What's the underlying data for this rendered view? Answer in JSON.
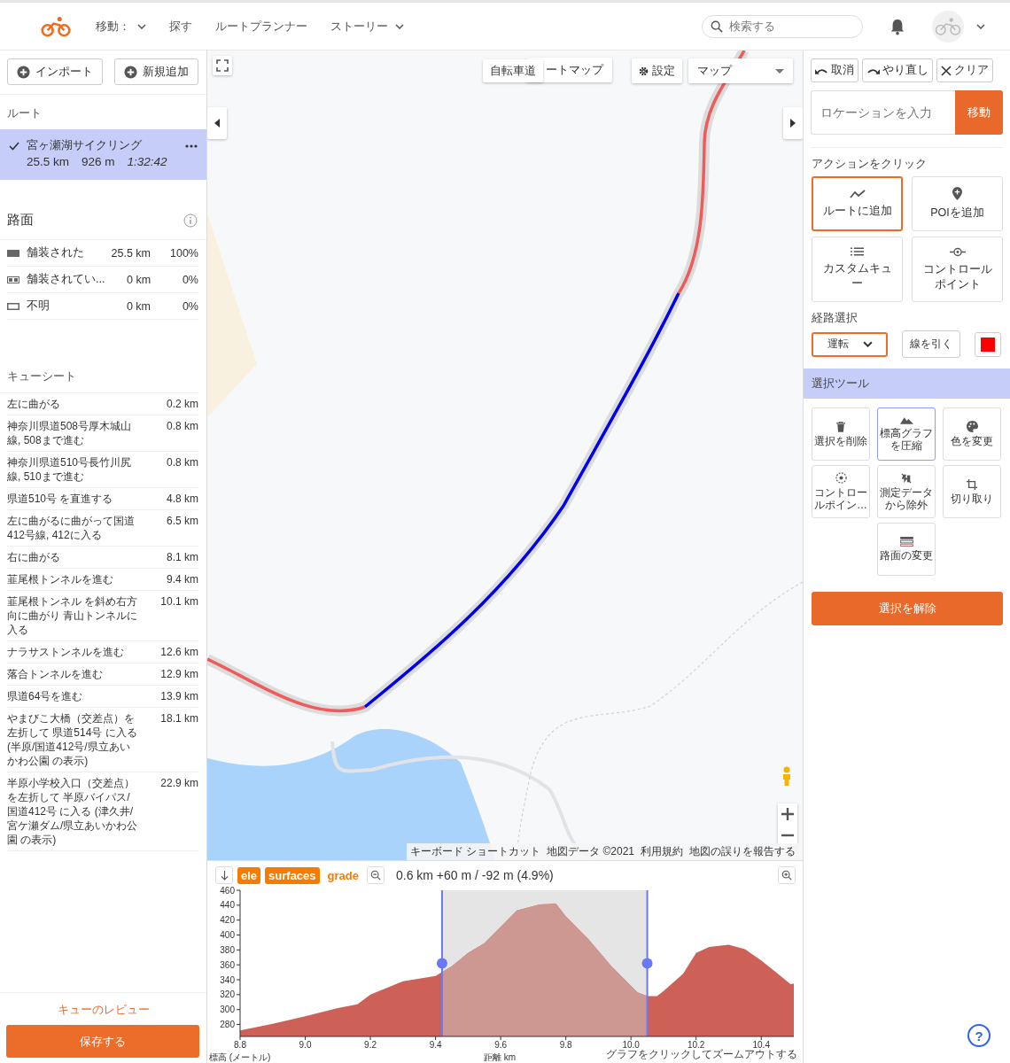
{
  "header": {
    "nav": [
      {
        "label": "移動：",
        "dropdown": true
      },
      {
        "label": "探す",
        "dropdown": false
      },
      {
        "label": "ルートプランナー",
        "dropdown": false
      },
      {
        "label": "ストーリー",
        "dropdown": true
      }
    ],
    "search": {
      "placeholder": "検索する"
    }
  },
  "sidebar": {
    "buttons": [
      "インポート",
      "新規追加"
    ],
    "routes_heading": "ルート",
    "routes": [
      {
        "name": "宮ヶ瀬湖サイクリング",
        "distance": "25.5 km",
        "elevation": "926 m",
        "time": "1:32:42",
        "selected": true
      }
    ],
    "surface": {
      "heading": "路面",
      "rows": [
        {
          "kind": "paved",
          "name": "舗装された",
          "distance": "25.5 km",
          "percent": "100%"
        },
        {
          "kind": "unpaved",
          "name": "舗装されてい...",
          "distance": "0 km",
          "percent": "0%"
        },
        {
          "kind": "unknown",
          "name": "不明",
          "distance": "0 km",
          "percent": "0%"
        }
      ]
    },
    "cue_sheet": {
      "heading": "キューシート",
      "rows": [
        {
          "text": "左に曲がる",
          "distance": "0.2 km"
        },
        {
          "text": "神奈川県道508号厚木城山線, 508まで進む",
          "distance": "0.8 km"
        },
        {
          "text": "神奈川県道510号長竹川尻線, 510まで進む",
          "distance": "0.8 km"
        },
        {
          "text": "県道510号 を直進する",
          "distance": "4.8 km"
        },
        {
          "text": "左に曲がるに曲がって国道412号線, 412に入る",
          "distance": "6.5 km"
        },
        {
          "text": "右に曲がる",
          "distance": "8.1 km"
        },
        {
          "text": "韮尾根トンネルを進む",
          "distance": "9.4 km"
        },
        {
          "text": "韮尾根トンネル を斜め右方向に曲がり 青山トンネルに入る",
          "distance": "10.1 km"
        },
        {
          "text": "ナラサストンネルを進む",
          "distance": "12.6 km"
        },
        {
          "text": "落合トンネルを進む",
          "distance": "12.9 km"
        },
        {
          "text": "県道64号を進む",
          "distance": "13.9 km"
        },
        {
          "text": "やまびこ大橋（交差点）を左折して 県道514号 に入る (半原/国道412号/県立あいかわ公園 の表示)",
          "distance": "18.1 km"
        },
        {
          "text": "半原小学校入口（交差点）を左折して 半原バイパス/国道412号 に入る (津久井/宮ケ瀬ダム/県立あいかわ公園 の表示)",
          "distance": "22.9 km"
        }
      ]
    },
    "review_link": "キューのレビュー",
    "save_button": "保存する"
  },
  "map": {
    "overlay_buttons": [
      "自転車道",
      "ートマップ"
    ],
    "settings_button": "設定",
    "map_type": "マップ",
    "attribution": [
      "キーボード ショートカット",
      "地図データ ©2021",
      "利用規約",
      "地図の誤りを報告する"
    ]
  },
  "elevation": {
    "tabs": [
      {
        "label": "ele",
        "selected": true
      },
      {
        "label": "surfaces",
        "selected": true
      },
      {
        "label": "grade",
        "selected": false
      }
    ],
    "summary": "0.6 km +60 m / -92 m (4.9%)",
    "hint": "グラフをクリックしてズームアウトする",
    "chart_data": {
      "type": "area",
      "xlabel": "距離 km",
      "ylabel": "標高 (メートル)",
      "x": [
        8.8,
        8.9,
        9.0,
        9.1,
        9.16,
        9.2,
        9.3,
        9.4,
        9.45,
        9.5,
        9.55,
        9.65,
        9.72,
        9.77,
        9.8,
        9.87,
        9.94,
        10.02,
        10.05,
        10.08,
        10.1,
        10.16,
        10.2,
        10.24,
        10.3,
        10.35,
        10.4,
        10.44,
        10.49,
        10.5
      ],
      "series": [
        {
          "color": "#cd6158",
          "values": [
            272,
            281,
            291,
            302,
            307,
            320,
            338,
            345,
            358,
            376,
            389,
            433,
            441,
            442,
            425,
            394,
            358,
            323,
            318,
            318,
            325,
            348,
            376,
            384,
            387,
            381,
            366,
            352,
            334,
            335
          ]
        }
      ],
      "xlim": [
        8.8,
        10.5
      ],
      "ylim": [
        264,
        460
      ],
      "xticks": [
        {
          "value": 8.8,
          "label": "8.8"
        },
        {
          "value": 9.0,
          "label": "9.0"
        },
        {
          "value": 9.2,
          "label": "9.2"
        },
        {
          "value": 9.4,
          "label": "9.4"
        },
        {
          "value": 9.6,
          "label": "9.6"
        },
        {
          "value": 9.8,
          "label": "9.8"
        },
        {
          "value": 10.0,
          "label": "10.0"
        },
        {
          "value": 10.2,
          "label": "10.2"
        },
        {
          "value": 10.4,
          "label": "10.4"
        }
      ],
      "yticks": [
        280,
        300,
        320,
        340,
        360,
        380,
        400,
        420,
        440,
        460
      ],
      "bands": [
        {
          "axis": "x",
          "from": 9.42,
          "to": 10.05
        }
      ],
      "ref_lines": [
        {
          "axis": "x",
          "value": 9.42
        },
        {
          "axis": "x",
          "value": 10.05
        }
      ]
    }
  },
  "right_panel": {
    "history_buttons": [
      {
        "kind": "undo",
        "label": "取消"
      },
      {
        "kind": "redo",
        "label": "やり直し"
      },
      {
        "kind": "clear",
        "label": "クリア"
      }
    ],
    "location": {
      "placeholder": "ロケーションを入力",
      "button": "移動"
    },
    "actions_heading": "アクションをクリック",
    "actions": [
      {
        "kind": "route",
        "label": "ルートに追加",
        "selected": true
      },
      {
        "kind": "poi",
        "label": "POIを追加",
        "selected": false
      },
      {
        "kind": "cue",
        "label": "カスタムキュー",
        "selected": false
      },
      {
        "kind": "control",
        "label": "コントロールポイント",
        "selected": false
      }
    ],
    "routing_heading": "経路選択",
    "routing_mode": "運転",
    "draw_button": "線を引く",
    "color_picker": {
      "color": "#ff0000"
    },
    "tools_heading": "選択ツール",
    "tools": [
      {
        "kind": "delete",
        "label": "選択を削除",
        "selected": false
      },
      {
        "kind": "compress",
        "label": "標高グラフを圧縮",
        "selected": true
      },
      {
        "kind": "palette",
        "label": "色を変更",
        "selected": false
      },
      {
        "kind": "control",
        "label": "コントロールポイン…",
        "selected": false
      },
      {
        "kind": "exclude",
        "label": "測定データから除外",
        "selected": false
      },
      {
        "kind": "crop",
        "label": "切り取り",
        "selected": false
      },
      {
        "kind": "surface",
        "label": "路面の変更",
        "selected": false
      }
    ],
    "deselect_button": "選択を解除"
  },
  "help_button": "?"
}
